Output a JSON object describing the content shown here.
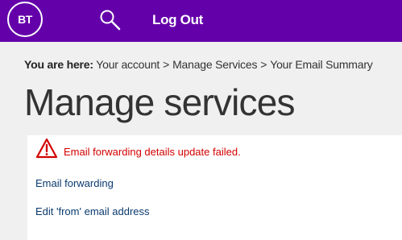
{
  "header": {
    "logo_text": "BT",
    "search_icon": "search-icon",
    "logout_label": "Log Out",
    "background_color": "#6400aa"
  },
  "breadcrumb": {
    "label": "You are here:",
    "items": [
      "Your account",
      "Manage Services",
      "Your Email Summary"
    ],
    "separator": ">"
  },
  "page": {
    "title": "Manage services"
  },
  "alert": {
    "icon": "warning-icon",
    "message": "Email forwarding details update failed.",
    "color": "#d30000"
  },
  "links": [
    {
      "label": "Email forwarding"
    },
    {
      "label": "Edit 'from' email address"
    }
  ]
}
